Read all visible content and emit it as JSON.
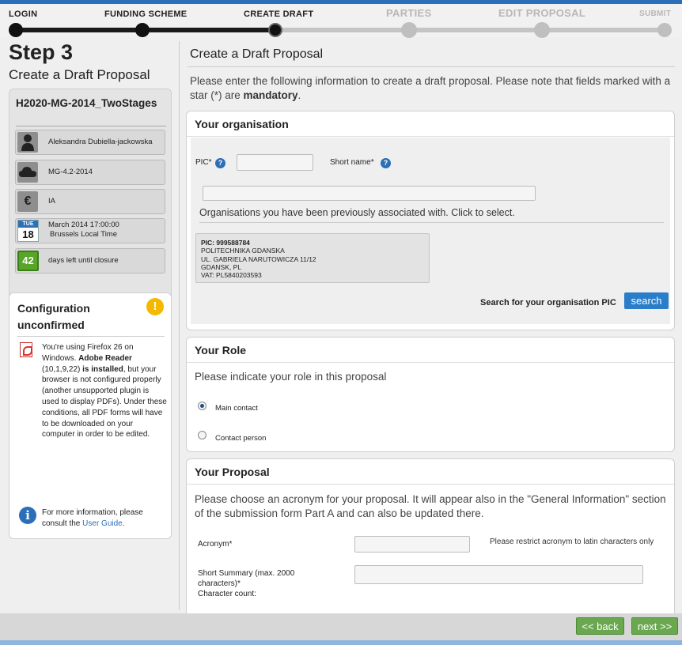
{
  "stepper": {
    "steps": [
      {
        "label": "LOGIN",
        "state": "done"
      },
      {
        "label": "FUNDING SCHEME",
        "state": "done"
      },
      {
        "label": "CREATE DRAFT",
        "state": "current"
      },
      {
        "label": "PARTIES",
        "state": "todo"
      },
      {
        "label": "EDIT PROPOSAL",
        "state": "todo"
      },
      {
        "label": "SUBMIT",
        "state": "todo"
      }
    ]
  },
  "sidebar": {
    "step_title": "Step 3",
    "step_subtitle": "Create a Draft Proposal",
    "call": {
      "identifier": "H2020-MG-2014_TwoStages",
      "items": [
        {
          "icon": "person-icon",
          "text": "Aleksandra Dubiella-jackowska"
        },
        {
          "icon": "cloud-icon",
          "text": "MG-4.2-2014"
        },
        {
          "icon": "euro-icon",
          "text": "IA"
        },
        {
          "icon": "calendar-icon",
          "cal_month": "TUE",
          "cal_day": "18",
          "text_line1": "March 2014 17:00:00",
          "text_line2": "Brussels Local Time"
        },
        {
          "icon": "days-counter-icon",
          "days": "42",
          "text": "days left until closure"
        }
      ]
    },
    "config": {
      "title": "Configuration unconfirmed",
      "warning_icon": "!",
      "msg_pre": "You're using Firefox 26 on Windows. ",
      "msg_bold1": "Adobe Reader",
      "msg_mid": " (10,1,9,22) ",
      "msg_bold2": "is installed",
      "msg_post": ", but your browser is not configured properly (another unsupported plugin is used to display PDFs). Under these conditions, all PDF forms will have to be downloaded on your computer in order to be edited.",
      "info_icon": "i",
      "info_pre": "For more information, please consult the ",
      "info_link": "User Guide",
      "info_post": "."
    }
  },
  "main": {
    "title": "Create a Draft Proposal",
    "intro_pre": "Please enter the following information to create a draft proposal. Please note that fields marked with a star (*) are ",
    "intro_bold": "mandatory",
    "intro_post": ".",
    "organisation": {
      "title": "Your organisation",
      "pic_label": "PIC*",
      "pic_value": "",
      "short_name_label": "Short name*",
      "short_name_value": "",
      "long_name_value": "",
      "list_title": "Organisations you have been previously associated with. Click to select.",
      "orgs": [
        {
          "pic": "PIC: 999588784",
          "name": "POLITECHNIKA GDANSKA",
          "street": "UL. GABRIELA NARUTOWICZA 11/12",
          "city": "GDANSK, PL",
          "vat": "VAT: PL5840203593"
        }
      ],
      "search_label": "Search for your organisation PIC",
      "search_button": "search"
    },
    "role": {
      "title": "Your Role",
      "prompt": "Please indicate your role in this proposal",
      "options": [
        {
          "label": "Main contact",
          "selected": true
        },
        {
          "label": "Contact person",
          "selected": false
        }
      ]
    },
    "proposal": {
      "title": "Your Proposal",
      "prompt": "Please choose an acronym for your proposal. It will appear also in the \"General Information\" section of the submission form Part A and can also be updated there.",
      "acronym_label": "Acronym*",
      "acronym_value": "",
      "acronym_hint": "Please restrict acronym to latin characters only",
      "summary_label": "Short Summary (max. 2000 characters)*",
      "char_count_label": "Character count:",
      "summary_value": ""
    }
  },
  "footer": {
    "back_button": "<< back",
    "next_button": "next >>"
  },
  "colors": {
    "accent_blue": "#2a6fb8",
    "button_green": "#6aa84f",
    "warning_yellow": "#f5b800"
  }
}
